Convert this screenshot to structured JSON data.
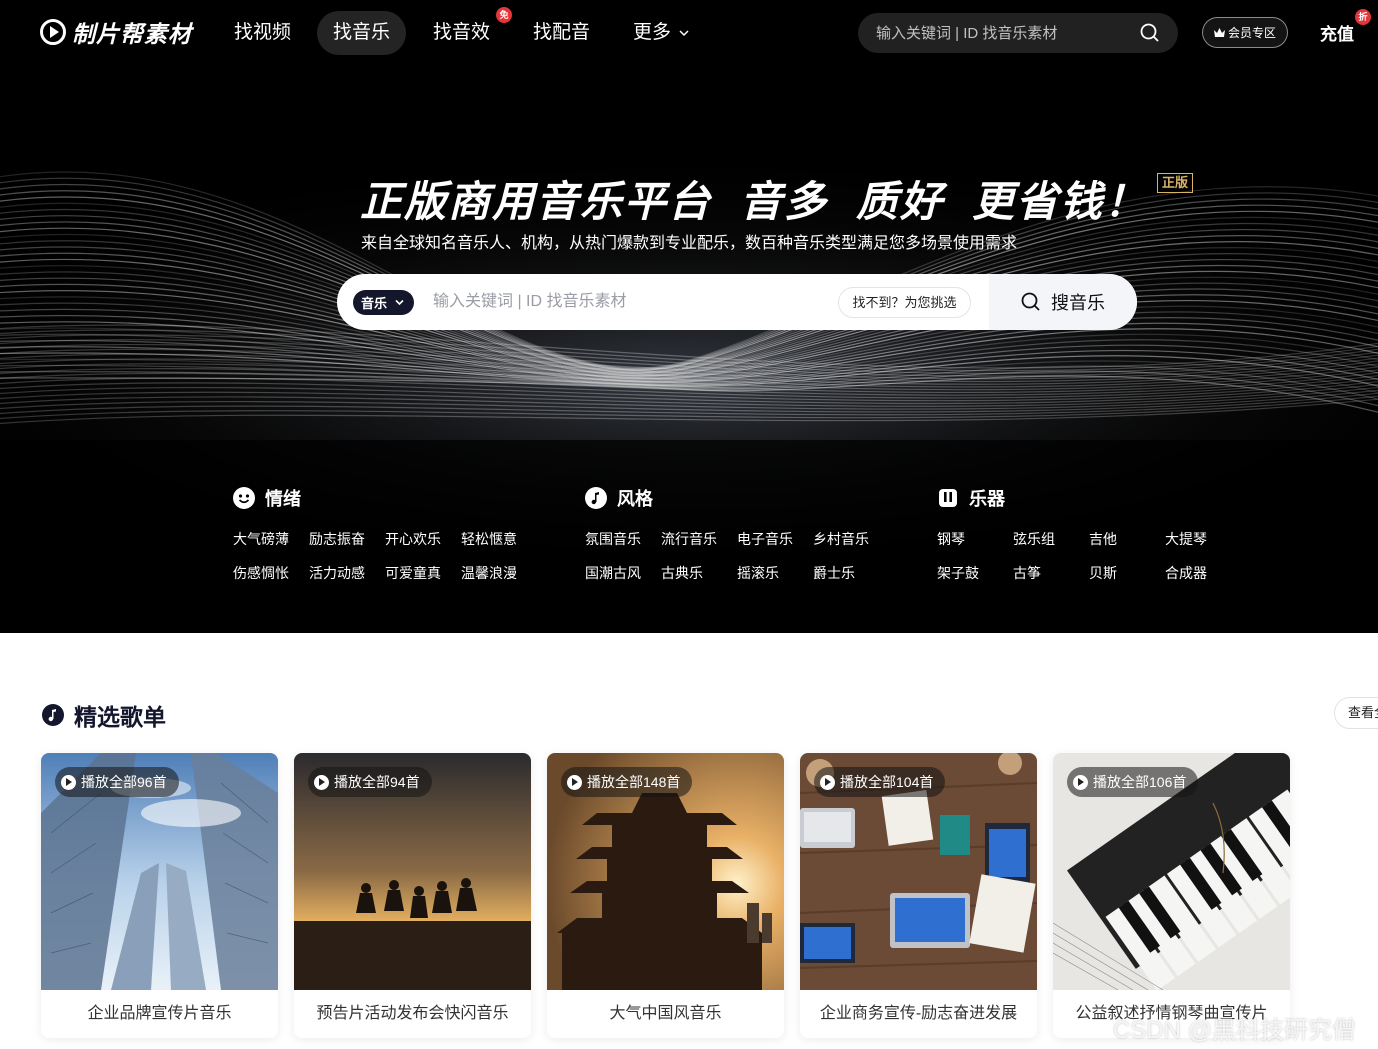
{
  "brand": {
    "name": "制片帮素材"
  },
  "nav": {
    "items": [
      {
        "label": "找视频",
        "badge": ""
      },
      {
        "label": "找音乐",
        "badge": ""
      },
      {
        "label": "找音效",
        "badge": "免"
      },
      {
        "label": "找配音",
        "badge": ""
      },
      {
        "label": "更多",
        "badge": ""
      }
    ],
    "active_index": 1,
    "search_placeholder": "输入关键词 | ID 找音乐素材",
    "vip_label": "会员专区",
    "recharge_label": "充值",
    "recharge_badge": "折"
  },
  "hero": {
    "title_parts": [
      "正版商用音乐平台",
      "音多",
      "质好",
      "更省钱！"
    ],
    "genuine_tag": "正版",
    "subtitle": "来自全球知名音乐人、机构，从热门爆款到专业配乐，数百种音乐类型满足您多场景使用需求",
    "search": {
      "scope": "音乐",
      "placeholder": "输入关键词 | ID 找音乐素材",
      "pick_label": "找不到？为您挑选",
      "submit_label": "搜音乐"
    }
  },
  "categories": [
    {
      "title": "情绪",
      "icon": "smiley-icon",
      "tags": [
        "大气磅薄",
        "励志振奋",
        "开心欢乐",
        "轻松惬意",
        "伤感惆怅",
        "活力动感",
        "可爱童真",
        "温馨浪漫"
      ]
    },
    {
      "title": "风格",
      "icon": "music-note-icon",
      "tags": [
        "氛围音乐",
        "流行音乐",
        "电子音乐",
        "乡村音乐",
        "国潮古风",
        "古典乐",
        "摇滚乐",
        "爵士乐"
      ]
    },
    {
      "title": "乐器",
      "icon": "instrument-icon",
      "tags": [
        "钢琴",
        "弦乐组",
        "吉他",
        "大提琴",
        "架子鼓",
        "古筝",
        "贝斯",
        "合成器"
      ]
    }
  ],
  "playlists": {
    "title": "精选歌单",
    "view_all": "查看全部",
    "items": [
      {
        "play_label": "播放全部96首",
        "name": "企业品牌宣传片音乐",
        "theme": "skyscrapers"
      },
      {
        "play_label": "播放全部94首",
        "name": "预告片活动发布会快闪音乐",
        "theme": "sunset-jump"
      },
      {
        "play_label": "播放全部148首",
        "name": "大气中国风音乐",
        "theme": "pagoda"
      },
      {
        "play_label": "播放全部104首",
        "name": "企业商务宣传-励志奋进发展",
        "theme": "office-desk"
      },
      {
        "play_label": "播放全部106首",
        "name": "公益叙述抒情钢琴曲宣传片",
        "theme": "piano"
      }
    ]
  },
  "watermark": "CSDN @黑科技研究僧",
  "colors": {
    "accent": "#14162c",
    "badge": "#e5353b",
    "gold": "#d7b46a"
  }
}
